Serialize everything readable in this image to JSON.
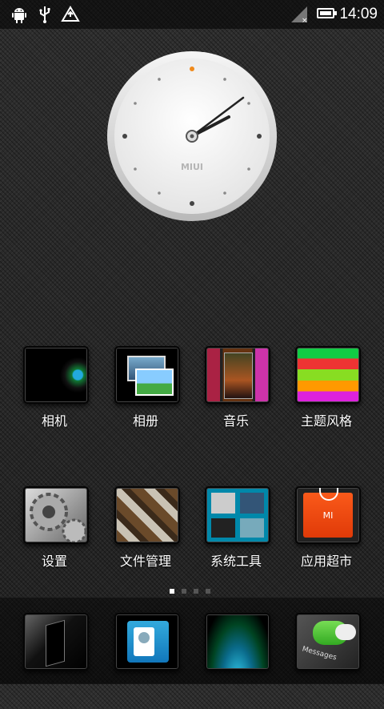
{
  "status_bar": {
    "time": "14:09",
    "icons": [
      "android-debug-icon",
      "usb-icon",
      "upload-warning-icon",
      "signal-icon",
      "battery-icon"
    ],
    "battery_level": 0.9
  },
  "clock_widget": {
    "brand": "MIUI",
    "time_shown": "14:09",
    "accent_color": "#f08a1c"
  },
  "apps_row1": [
    {
      "label": "相机",
      "icon": "camera-lens-icon"
    },
    {
      "label": "相册",
      "icon": "gallery-icon"
    },
    {
      "label": "音乐",
      "icon": "music-player-icon"
    },
    {
      "label": "主题风格",
      "icon": "theme-icon"
    }
  ],
  "apps_row2": [
    {
      "label": "设置",
      "icon": "gear-icon"
    },
    {
      "label": "文件管理",
      "icon": "file-manager-icon"
    },
    {
      "label": "系统工具",
      "icon": "system-tools-icon"
    },
    {
      "label": "应用超市",
      "icon": "app-store-icon"
    }
  ],
  "app_store_badge": "MI",
  "page_indicator": {
    "count": 4,
    "active": 0
  },
  "dock": [
    {
      "icon": "phone-icon"
    },
    {
      "icon": "contacts-icon"
    },
    {
      "icon": "browser-globe-icon"
    },
    {
      "icon": "messages-icon"
    }
  ],
  "dock_text": {
    "messages": "Messages"
  }
}
